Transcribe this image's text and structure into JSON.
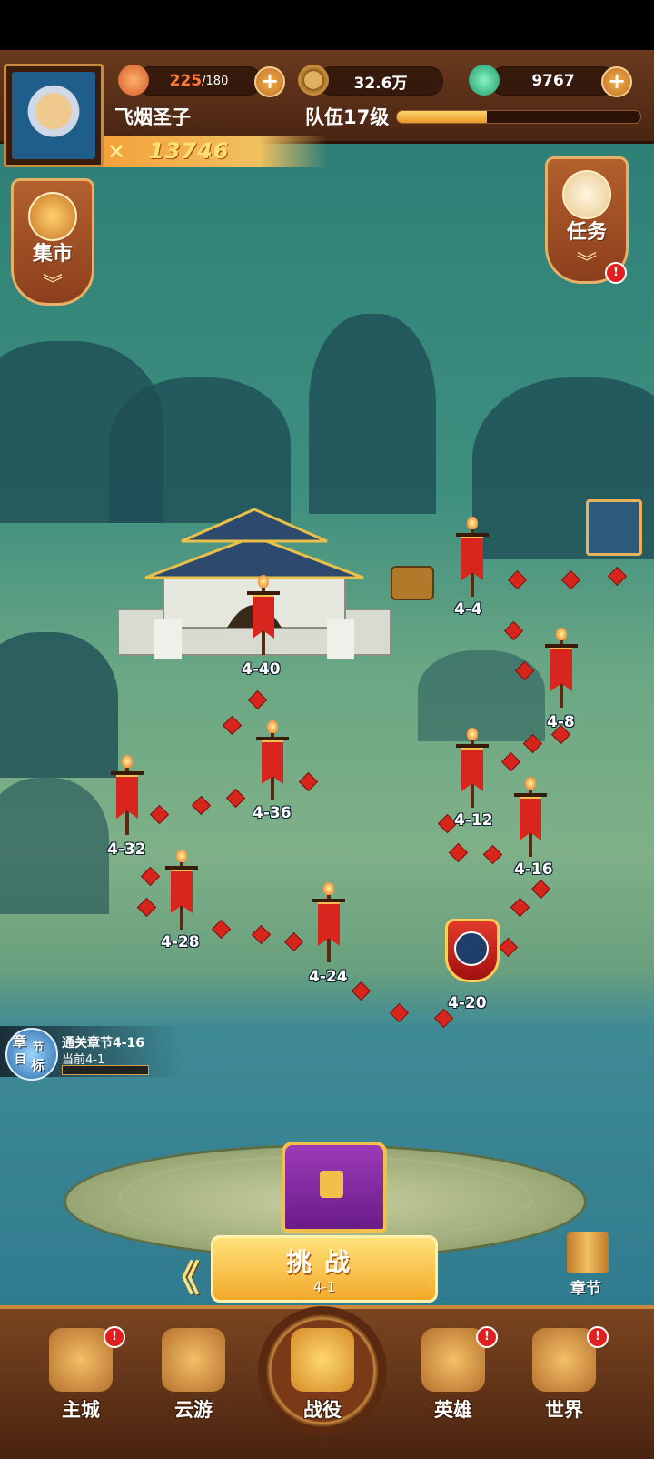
{
  "header": {
    "stamina": {
      "current": "225",
      "max": "/180",
      "icon": "meat-icon"
    },
    "copper": {
      "value": "32.6万",
      "icon": "coin-icon"
    },
    "jade": {
      "value": "9767",
      "icon": "jade-icon"
    },
    "player_name": "飞烟圣子",
    "team_level": "队伍17级",
    "exp_progress": 0.37,
    "power": "13746"
  },
  "side": {
    "market_label": "集市",
    "tasks_label": "任务"
  },
  "stages": [
    {
      "label": "4-4"
    },
    {
      "label": "4-8"
    },
    {
      "label": "4-12"
    },
    {
      "label": "4-16"
    },
    {
      "label": "4-20"
    },
    {
      "label": "4-24"
    },
    {
      "label": "4-28"
    },
    {
      "label": "4-32"
    },
    {
      "label": "4-36"
    },
    {
      "label": "4-40"
    }
  ],
  "goal": {
    "icon_text": [
      "章",
      "节",
      "目",
      "标"
    ],
    "title": "通关章节4-16",
    "current": "当前4-1",
    "progress": 0.0
  },
  "challenge": {
    "label": "挑战",
    "stage": "4-1"
  },
  "chapters_label": "章节",
  "nav": [
    {
      "label": "主城",
      "icon": "palace-icon",
      "badge": "!"
    },
    {
      "label": "云游",
      "icon": "gourd-icon",
      "badge": ""
    },
    {
      "label": "战役",
      "icon": "crossed-swords-icon",
      "badge": ""
    },
    {
      "label": "英雄",
      "icon": "helmet-icon",
      "badge": "!"
    },
    {
      "label": "世界",
      "icon": "mountain-icon",
      "badge": "!"
    }
  ],
  "colors": {
    "flag_red": "#d8261e",
    "gold": "#f3a92a",
    "header_brown": "#6a3a1e"
  }
}
